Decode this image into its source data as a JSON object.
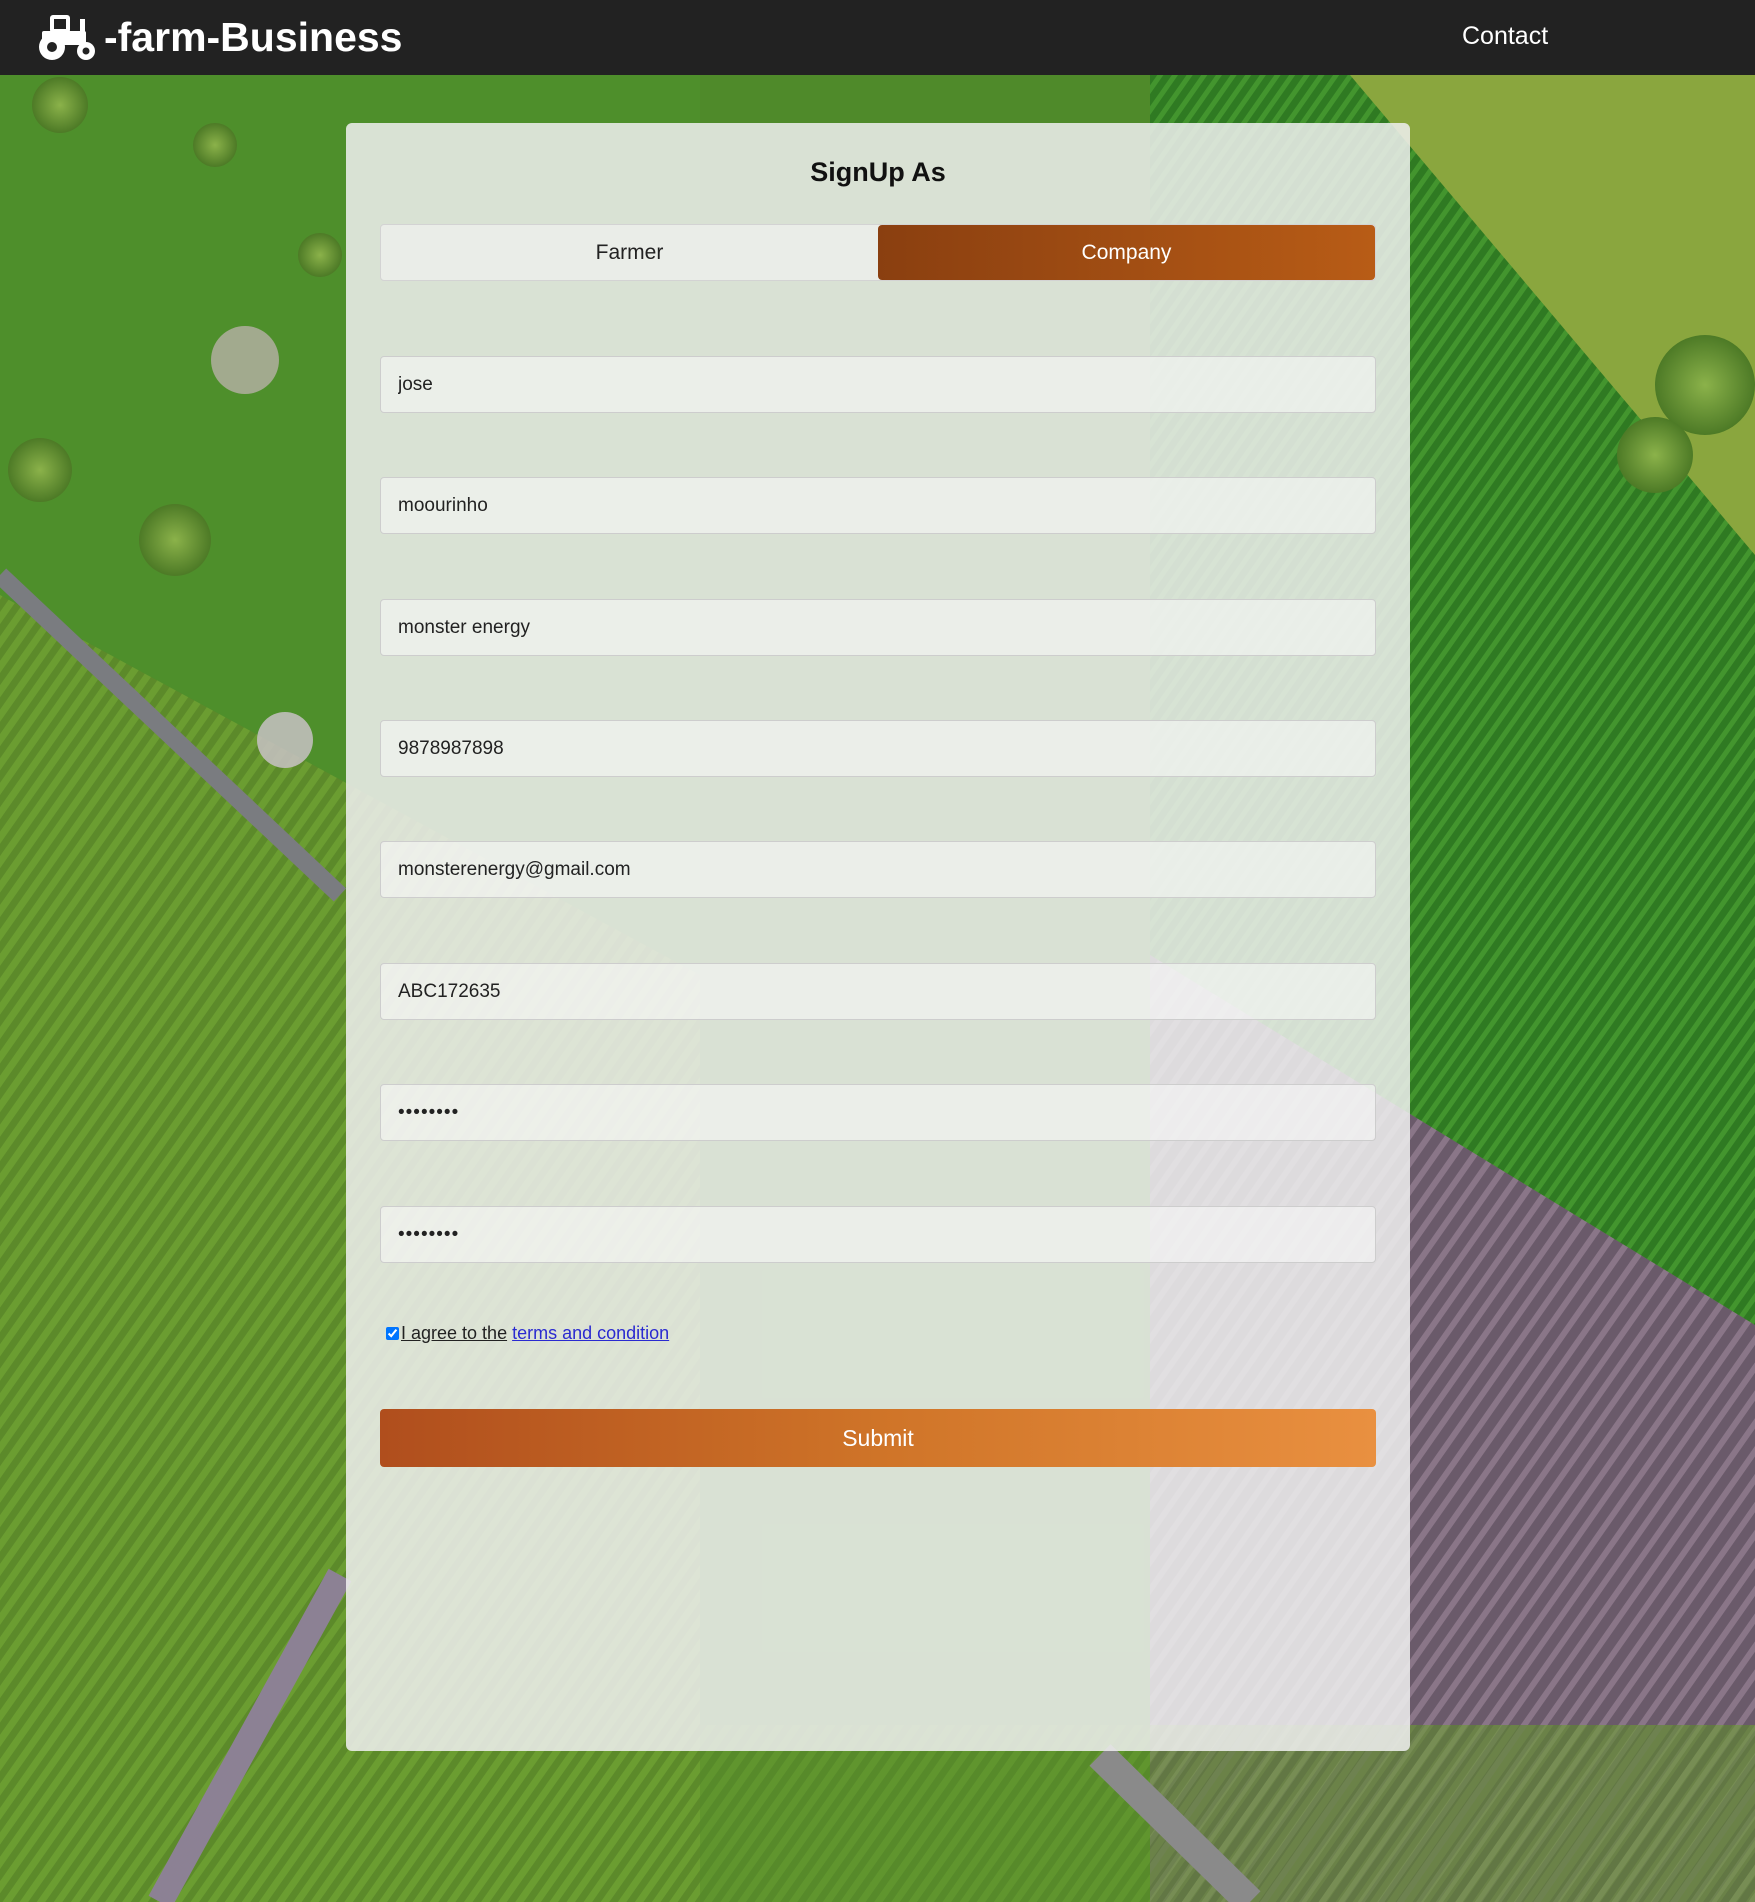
{
  "navbar": {
    "brand": "-farm-Business",
    "contact_label": "Contact"
  },
  "form": {
    "title": "SignUp As",
    "tabs": [
      {
        "label": "Farmer",
        "active": false
      },
      {
        "label": "Company",
        "active": true
      }
    ],
    "fields": [
      {
        "name": "first-name",
        "value": "jose",
        "type": "text"
      },
      {
        "name": "last-name",
        "value": "moourinho",
        "type": "text"
      },
      {
        "name": "company-name",
        "value": "monster energy",
        "type": "text"
      },
      {
        "name": "phone",
        "value": "9878987898",
        "type": "text"
      },
      {
        "name": "email",
        "value": "monsterenergy@gmail.com",
        "type": "text"
      },
      {
        "name": "company-id",
        "value": "ABC172635",
        "type": "text"
      },
      {
        "name": "password",
        "value": "abcd1234",
        "type": "password"
      },
      {
        "name": "confirm-password",
        "value": "abcd1234",
        "type": "password"
      }
    ],
    "agree_text": "I agree to the",
    "terms_link": "terms and condition",
    "agree_checked": true,
    "submit_label": "Submit"
  },
  "colors": {
    "navbar": "#222222",
    "accent_active_tab": "#9a4a12",
    "submit_start": "#b04e1d",
    "submit_end": "#e99040",
    "link": "#2a2ad0"
  }
}
